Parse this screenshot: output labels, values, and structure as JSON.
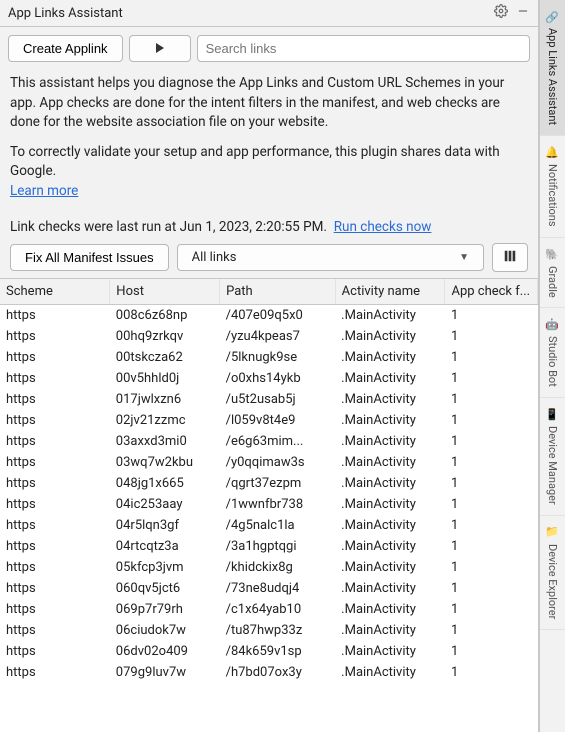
{
  "header": {
    "title": "App Links Assistant"
  },
  "toolbar": {
    "create_label": "Create Applink",
    "search_placeholder": "Search links"
  },
  "description": {
    "para1": "This assistant helps you diagnose the App Links and Custom URL Schemes in your app. App checks are done for the intent filters in the manifest, and web checks are done for the website association file on your website.",
    "para2": "To correctly validate your setup and app performance, this plugin shares data with Google.",
    "learn_more": "Learn more"
  },
  "status": {
    "last_run_prefix": "Link checks were last run at ",
    "last_run_time": "Jun 1, 2023, 2:20:55 PM",
    "run_now": "Run checks now"
  },
  "filters": {
    "fix_label": "Fix All Manifest Issues",
    "dropdown_value": "All links"
  },
  "table": {
    "headers": [
      "Scheme",
      "Host",
      "Path",
      "Activity name",
      "App check f..."
    ],
    "rows": [
      {
        "scheme": "https",
        "host": "008c6z68np",
        "path": "/407e09q5x0",
        "activity": ".MainActivity",
        "appcheck": "1"
      },
      {
        "scheme": "https",
        "host": "00hq9zrkqv",
        "path": "/yzu4kpeas7",
        "activity": ".MainActivity",
        "appcheck": "1"
      },
      {
        "scheme": "https",
        "host": "00tskcza62",
        "path": "/5lknugk9se",
        "activity": ".MainActivity",
        "appcheck": "1"
      },
      {
        "scheme": "https",
        "host": "00v5hhld0j",
        "path": "/o0xhs14ykb",
        "activity": ".MainActivity",
        "appcheck": "1"
      },
      {
        "scheme": "https",
        "host": "017jwlxzn6",
        "path": "/u5t2usab5j",
        "activity": ".MainActivity",
        "appcheck": "1"
      },
      {
        "scheme": "https",
        "host": "02jv21zzmc",
        "path": "/l059v8t4e9",
        "activity": ".MainActivity",
        "appcheck": "1"
      },
      {
        "scheme": "https",
        "host": "03axxd3mi0",
        "path": "/e6g63mim...",
        "activity": ".MainActivity",
        "appcheck": "1"
      },
      {
        "scheme": "https",
        "host": "03wq7w2kbu",
        "path": "/y0qqimaw3s",
        "activity": ".MainActivity",
        "appcheck": "1"
      },
      {
        "scheme": "https",
        "host": "048jg1x665",
        "path": "/qgrt37ezpm",
        "activity": ".MainActivity",
        "appcheck": "1"
      },
      {
        "scheme": "https",
        "host": "04ic253aay",
        "path": "/1wwnfbr738",
        "activity": ".MainActivity",
        "appcheck": "1"
      },
      {
        "scheme": "https",
        "host": "04r5lqn3gf",
        "path": "/4g5nalc1la",
        "activity": ".MainActivity",
        "appcheck": "1"
      },
      {
        "scheme": "https",
        "host": "04rtcqtz3a",
        "path": "/3a1hgptqgi",
        "activity": ".MainActivity",
        "appcheck": "1"
      },
      {
        "scheme": "https",
        "host": "05kfcp3jvm",
        "path": "/khidckix8g",
        "activity": ".MainActivity",
        "appcheck": "1"
      },
      {
        "scheme": "https",
        "host": "060qv5jct6",
        "path": "/73ne8udqj4",
        "activity": ".MainActivity",
        "appcheck": "1"
      },
      {
        "scheme": "https",
        "host": "069p7r79rh",
        "path": "/c1x64yab10",
        "activity": ".MainActivity",
        "appcheck": "1"
      },
      {
        "scheme": "https",
        "host": "06ciudok7w",
        "path": "/tu87hwp33z",
        "activity": ".MainActivity",
        "appcheck": "1"
      },
      {
        "scheme": "https",
        "host": "06dv02o409",
        "path": "/84k659v1sp",
        "activity": ".MainActivity",
        "appcheck": "1"
      },
      {
        "scheme": "https",
        "host": "079g9luv7w",
        "path": "/h7bd07ox3y",
        "activity": ".MainActivity",
        "appcheck": "1"
      }
    ]
  },
  "side_rail": {
    "items": [
      {
        "label": "App Links Assistant",
        "icon": "link-icon",
        "active": true
      },
      {
        "label": "Notifications",
        "icon": "bell-icon",
        "active": false
      },
      {
        "label": "Gradle",
        "icon": "elephant-icon",
        "active": false
      },
      {
        "label": "Studio Bot",
        "icon": "bot-icon",
        "active": false
      },
      {
        "label": "Device Manager",
        "icon": "phone-icon",
        "active": false
      },
      {
        "label": "Device Explorer",
        "icon": "folder-icon",
        "active": false
      }
    ]
  }
}
